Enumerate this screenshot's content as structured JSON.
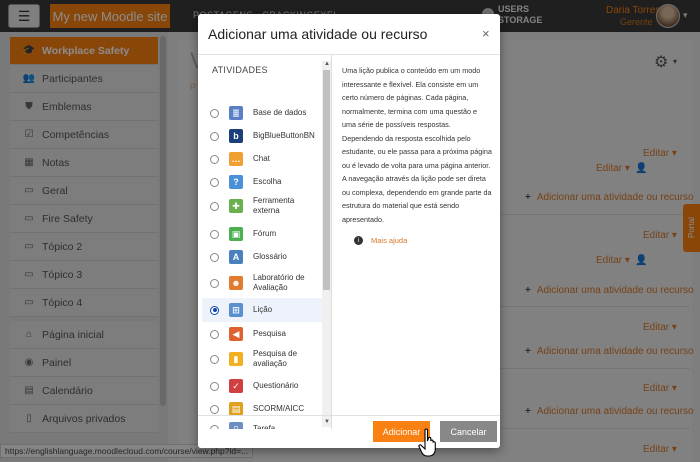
{
  "navbar": {
    "site_name": "My new Moodle site",
    "mid_text": "POSTAGENS · CRACKINGEXEL",
    "users_storage_line1": "USERS",
    "users_storage_line2": "STORAGE",
    "user_name": "Daria Torres",
    "user_role": "Gerente"
  },
  "sidebar": {
    "course_items": [
      {
        "label": "Workplace Safety",
        "icon": "graduation-cap-icon",
        "active": true
      },
      {
        "label": "Participantes",
        "icon": "users-icon"
      },
      {
        "label": "Emblemas",
        "icon": "shield-icon"
      },
      {
        "label": "Competências",
        "icon": "checkbox-icon"
      },
      {
        "label": "Notas",
        "icon": "table-icon"
      },
      {
        "label": "Geral",
        "icon": "folder-icon"
      },
      {
        "label": "Fire Safety",
        "icon": "folder-icon"
      },
      {
        "label": "Tópico 2",
        "icon": "folder-icon"
      },
      {
        "label": "Tópico 3",
        "icon": "folder-icon"
      },
      {
        "label": "Tópico 4",
        "icon": "folder-icon"
      }
    ],
    "site_items": [
      {
        "label": "Página inicial",
        "icon": "home-icon"
      },
      {
        "label": "Painel",
        "icon": "dashboard-icon"
      },
      {
        "label": "Calendário",
        "icon": "calendar-icon"
      },
      {
        "label": "Arquivos privados",
        "icon": "file-icon"
      }
    ]
  },
  "main": {
    "title_letter": "V",
    "sub_letter": "P",
    "editar_label": "Editar",
    "add_activity_label": "Adicionar uma atividade ou recurso",
    "portal_label": "Portal"
  },
  "status_url": "https://englishlanguage.moodlecloud.com/course/view.php?id=...",
  "modal": {
    "title": "Adicionar uma atividade ou recurso",
    "close_symbol": "×",
    "list_header": "ATIVIDADES",
    "activities": [
      {
        "label": "Base de dados",
        "icon": "database-icon",
        "color": "#5b7fc7"
      },
      {
        "label": "BigBlueButtonBN",
        "icon": "bigbluebutton-icon",
        "color": "#1a3f7a"
      },
      {
        "label": "Chat",
        "icon": "chat-icon",
        "color": "#f0a030"
      },
      {
        "label": "Escolha",
        "icon": "question-icon",
        "color": "#4a90d9"
      },
      {
        "label": "Ferramenta externa",
        "icon": "puzzle-icon",
        "color": "#6ab04c"
      },
      {
        "label": "Fórum",
        "icon": "forum-icon",
        "color": "#4caf50"
      },
      {
        "label": "Glossário",
        "icon": "glossary-icon",
        "color": "#4a7fc0"
      },
      {
        "label": "Laboratório de Avaliação",
        "icon": "workshop-icon",
        "color": "#e07b30"
      },
      {
        "label": "Lição",
        "icon": "lesson-icon",
        "color": "#5a8fd0",
        "selected": true
      },
      {
        "label": "Pesquisa",
        "icon": "megaphone-icon",
        "color": "#e06030"
      },
      {
        "label": "Pesquisa de avaliação",
        "icon": "bar-chart-icon",
        "color": "#f0b020"
      },
      {
        "label": "Questionário",
        "icon": "quiz-icon",
        "color": "#d04040"
      },
      {
        "label": "SCORM/AICC",
        "icon": "scorm-icon",
        "color": "#e0a020"
      },
      {
        "label": "Tarefa",
        "icon": "assignment-icon",
        "color": "#6a8fc0"
      }
    ],
    "description": "Uma lição publica o conteúdo em um modo interessante e flexível. Ela consiste em um certo número de páginas. Cada página, normalmente, termina com uma questão e uma série de possíveis respostas. Dependendo da resposta escolhida pelo estudante, ou ele passa para a próxima página ou é levado de volta para uma página anterior. A navegação através da lição pode ser direta ou complexa, dependendo em grande parte da estrutura do material que está sendo apresentado.",
    "help_link": "Mais ajuda",
    "add_button": "Adicionar",
    "cancel_button": "Cancelar"
  }
}
